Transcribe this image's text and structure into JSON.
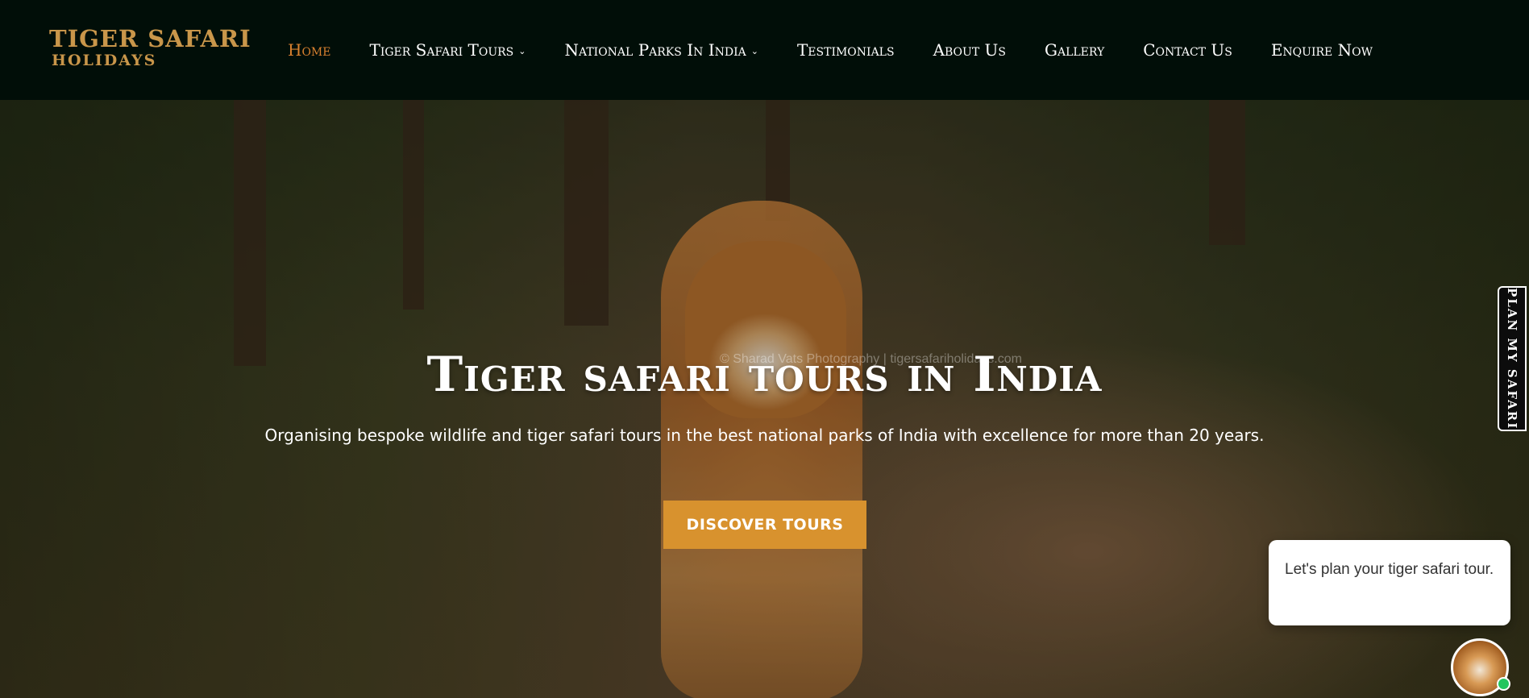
{
  "logo": {
    "line1": "TIGER SAFARI",
    "line2": "HOLIDAYS"
  },
  "nav": {
    "items": [
      {
        "label": "Home",
        "active": true,
        "dropdown": false
      },
      {
        "label": "Tiger Safari Tours",
        "active": false,
        "dropdown": true
      },
      {
        "label": "National Parks In India",
        "active": false,
        "dropdown": true
      },
      {
        "label": "Testimonials",
        "active": false,
        "dropdown": false
      },
      {
        "label": "About Us",
        "active": false,
        "dropdown": false
      },
      {
        "label": "Gallery",
        "active": false,
        "dropdown": false
      },
      {
        "label": "Contact Us",
        "active": false,
        "dropdown": false
      },
      {
        "label": "Enquire Now",
        "active": false,
        "dropdown": false
      }
    ],
    "chevron_icon": "chevron-down-icon"
  },
  "hero": {
    "watermark": "© Sharad Vats Photography | tigersafariholidays.com",
    "title": "Tiger safari tours in India",
    "subtitle": "Organising bespoke wildlife and tiger safari tours in the best national parks of India with excellence for more than 20 years.",
    "cta_label": "DISCOVER TOURS"
  },
  "side_tab": {
    "label": "PLAN MY SAFARI"
  },
  "chat": {
    "message": "Let's plan your tiger safari tour."
  },
  "colors": {
    "nav_bg": "#010e08",
    "accent": "#d8922e",
    "active_link": "#d9812f",
    "logo_gold": "#c9964a",
    "online": "#22c55e"
  }
}
